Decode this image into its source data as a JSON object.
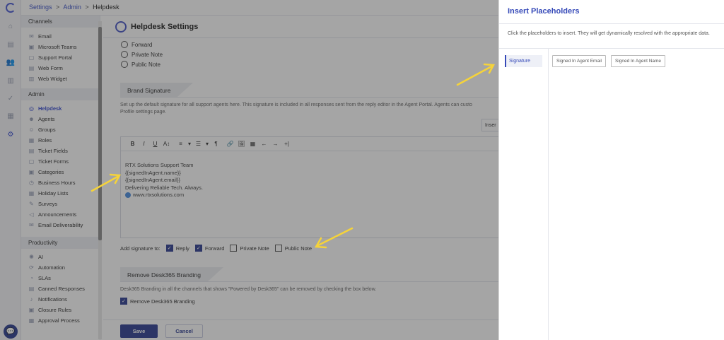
{
  "breadcrumb": {
    "item1": "Settings",
    "item2": "Admin",
    "current": "Helpdesk",
    "sep": ">"
  },
  "sidebar": {
    "sections": [
      {
        "title": "Channels",
        "items": [
          {
            "label": "Email",
            "icon": "email-icon"
          },
          {
            "label": "Microsoft Teams",
            "icon": "teams-icon"
          },
          {
            "label": "Support Portal",
            "icon": "portal-icon"
          },
          {
            "label": "Web Form",
            "icon": "form-icon"
          },
          {
            "label": "Web Widget",
            "icon": "widget-icon"
          }
        ]
      },
      {
        "title": "Admin",
        "items": [
          {
            "label": "Helpdesk",
            "icon": "helpdesk-icon",
            "active": true
          },
          {
            "label": "Agents",
            "icon": "agent-icon"
          },
          {
            "label": "Groups",
            "icon": "groups-icon"
          },
          {
            "label": "Roles",
            "icon": "roles-icon"
          },
          {
            "label": "Ticket Fields",
            "icon": "fields-icon"
          },
          {
            "label": "Ticket Forms",
            "icon": "forms-icon"
          },
          {
            "label": "Categories",
            "icon": "categories-icon"
          },
          {
            "label": "Business Hours",
            "icon": "clock-icon"
          },
          {
            "label": "Holiday Lists",
            "icon": "calendar-icon"
          },
          {
            "label": "Surveys",
            "icon": "survey-icon"
          },
          {
            "label": "Announcements",
            "icon": "megaphone-icon"
          },
          {
            "label": "Email Deliverability",
            "icon": "envelope-icon"
          }
        ]
      },
      {
        "title": "Productivity",
        "items": [
          {
            "label": "AI",
            "icon": "ai-icon"
          },
          {
            "label": "Automation",
            "icon": "automation-icon"
          },
          {
            "label": "SLAs",
            "icon": "sla-icon"
          },
          {
            "label": "Canned Responses",
            "icon": "canned-icon"
          },
          {
            "label": "Notifications",
            "icon": "bell-icon"
          },
          {
            "label": "Closure Rules",
            "icon": "closure-icon"
          },
          {
            "label": "Approval Process",
            "icon": "approval-icon"
          }
        ]
      }
    ]
  },
  "page": {
    "title": "Helpdesk Settings",
    "radios": [
      "Forward",
      "Private Note",
      "Public Note"
    ],
    "brand_signature": {
      "title": "Brand Signature",
      "help": "Set up the default signature for all support agents here. This signature is included in all responses sent from the reply editor in the Agent Portal. Agents can custo",
      "help_line2": "Profile settings page.",
      "insert_label": "Inser",
      "toolbar": [
        "B",
        "I",
        "U",
        "A↕",
        "≡",
        "▾",
        "☰",
        "▾",
        "¶",
        "🔗",
        "🖼",
        "▦",
        "←",
        "→",
        "+|"
      ],
      "signature_lines": [
        "RTX Solutions Support Team",
        "{{signedInAgent.name}}",
        "{{signedInAgent.email}}",
        "Delivering Reliable Tech. Always."
      ],
      "website": "www.rtxsolutions.com",
      "add_signature_label": "Add signature to:",
      "options": [
        {
          "label": "Reply",
          "checked": true
        },
        {
          "label": "Forward",
          "checked": true
        },
        {
          "label": "Private Note",
          "checked": false
        },
        {
          "label": "Public Note",
          "checked": false
        }
      ]
    },
    "remove_branding": {
      "title": "Remove Desk365 Branding",
      "help": "Desk365 Branding in all the channels that shows \"Powered by Desk365\" can be removed by checking the box below.",
      "checkbox_label": "Remove Desk365 Branding",
      "checked": true
    },
    "save_label": "Save",
    "cancel_label": "Cancel"
  },
  "panel": {
    "title": "Insert Placeholders",
    "description": "Click the placeholders to insert. They will get dynamically resolved with the appropriate data.",
    "tab": "Signature",
    "placeholders": [
      "Signed In Agent Email",
      "Signed In Agent Name"
    ]
  },
  "colors": {
    "accent": "#2f3e93",
    "link": "#3b52c8",
    "panel_title": "#3549b8",
    "arrow": "#f5d33a"
  }
}
